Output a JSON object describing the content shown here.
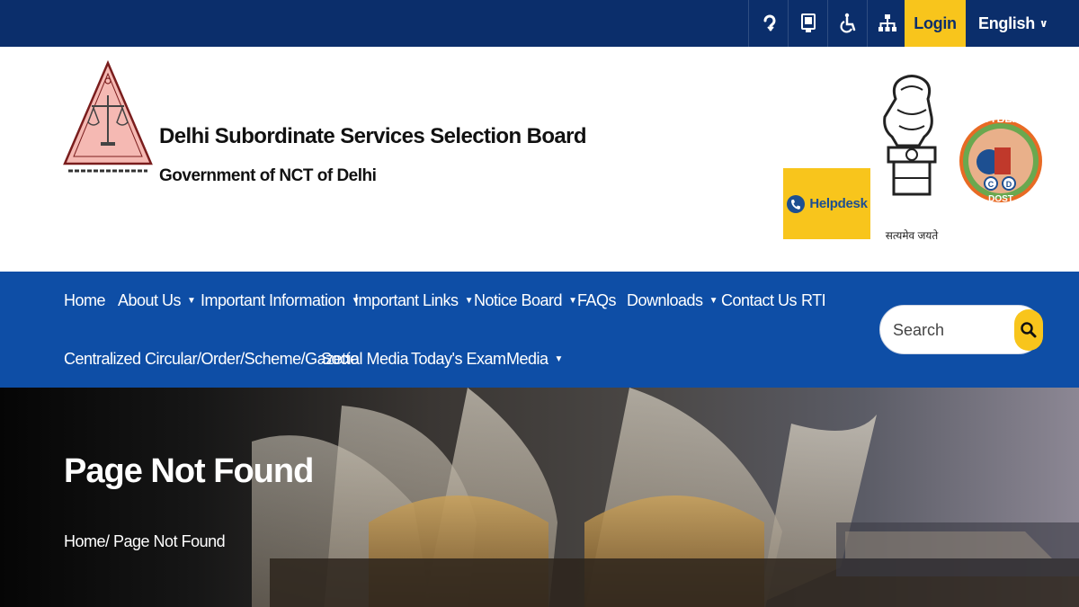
{
  "topbar": {
    "tools": [
      {
        "icon": "screen-reader-icon"
      },
      {
        "icon": "text-size-icon"
      },
      {
        "icon": "accessibility-icon"
      },
      {
        "icon": "sitemap-icon"
      }
    ],
    "login_label": "Login",
    "language": "English",
    "colors": {
      "bar": "#0b2e6b",
      "accent": "#f8c51c"
    }
  },
  "header": {
    "org_name": "Delhi Subordinate Services Selection Board",
    "org_subtitle": "Government of NCT of Delhi",
    "helpdesk_label": "Helpdesk",
    "emblem_motto": "सत्यमेव जयते",
    "cyber_top": "CYBER",
    "cyber_bottom": "DOST"
  },
  "nav": {
    "items": [
      {
        "label": "Home",
        "dropdown": false
      },
      {
        "label": "About Us",
        "dropdown": true
      },
      {
        "label": "Important Information",
        "dropdown": true
      },
      {
        "label": "Important Links",
        "dropdown": true
      },
      {
        "label": "Notice Board",
        "dropdown": true
      },
      {
        "label": "FAQs",
        "dropdown": false
      },
      {
        "label": "Downloads",
        "dropdown": true
      },
      {
        "label": "Contact Us",
        "dropdown": false
      },
      {
        "label": "RTI",
        "dropdown": false
      },
      {
        "label": "Centralized Circular/Order/Scheme/Gazette",
        "dropdown": false
      },
      {
        "label": "Social Media",
        "dropdown": false
      },
      {
        "label": "Today's Exam",
        "dropdown": false
      },
      {
        "label": "Media",
        "dropdown": true
      }
    ],
    "search_placeholder": "Search",
    "color": "#0e4ea6"
  },
  "hero": {
    "title": "Page Not Found",
    "breadcrumb": "Home/ Page Not Found"
  }
}
